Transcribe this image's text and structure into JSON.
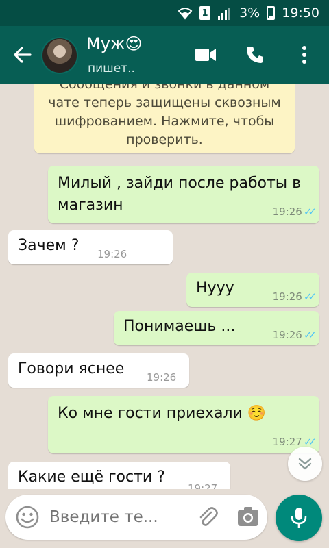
{
  "status_bar": {
    "sim_label": "1",
    "battery": "3%",
    "time": "19:50"
  },
  "header": {
    "contact_name": "Муж",
    "contact_emoji": "😍",
    "status": "пишет.."
  },
  "encryption_notice": "Сообщения и звонки в данном чате теперь защищены сквозным шифрованием. Нажмите, чтобы проверить.",
  "messages": [
    {
      "direction": "out",
      "text": "Милый , зайди после работы в магазин",
      "time": "19:26",
      "read": true
    },
    {
      "direction": "in",
      "text": "Зачем ?",
      "time": "19:26"
    },
    {
      "direction": "out",
      "text": "Нууу",
      "time": "19:26",
      "read": true
    },
    {
      "direction": "out",
      "text": "Понимаешь ...",
      "time": "19:26",
      "read": true
    },
    {
      "direction": "in",
      "text": "Говори яснее",
      "time": "19:26"
    },
    {
      "direction": "out",
      "text": "Ко мне гости приехали ☺️",
      "time": "19:27",
      "read": true
    },
    {
      "direction": "in",
      "text": "Какие ещё гости ?",
      "time": "19:27"
    }
  ],
  "input": {
    "placeholder": "Введите те..."
  },
  "colors": {
    "header": "#075e54",
    "status_bar": "#054d44",
    "outgoing_bubble": "#dcf8c6",
    "incoming_bubble": "#ffffff",
    "mic_button": "#00897b",
    "read_ticks": "#4fc3f7"
  },
  "icons": {
    "back": "arrow-left-icon",
    "video": "video-call-icon",
    "call": "phone-icon",
    "menu": "more-vert-icon",
    "emoji": "emoji-icon",
    "attach": "paperclip-icon",
    "camera": "camera-icon",
    "mic": "mic-icon",
    "scroll": "chevron-double-down-icon"
  }
}
